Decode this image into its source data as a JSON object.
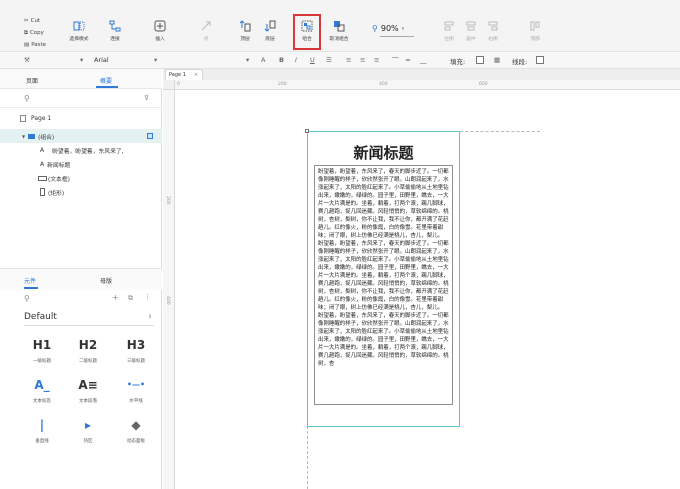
{
  "toolbar": {
    "clipboard": {
      "cut": "Cut",
      "copy": "Copy",
      "paste": "Paste"
    },
    "buttons": {
      "select_mode": "选择模式",
      "connect": "连接",
      "insert": "插入",
      "point": "点",
      "top_layer": "顶层",
      "bottom_layer": "底层",
      "group": "组合",
      "ungroup": "取消组合",
      "align_left": "左侧",
      "align_center": "居中",
      "align_right": "右侧",
      "top": "顶部"
    },
    "zoom": "90%"
  },
  "format_bar": {
    "font": "Arial",
    "fill_label": "填充:",
    "line_label": "线段:"
  },
  "left_panel": {
    "tabs": {
      "pages": "页面",
      "outline": "概要"
    },
    "page_name": "Page 1",
    "outline": [
      {
        "label": "(组合)",
        "type": "group"
      },
      {
        "label": "盼望着，盼望着，东风来了,",
        "type": "text"
      },
      {
        "label": "新闻标题",
        "type": "text"
      },
      {
        "label": "(文本框)",
        "type": "textbox"
      },
      {
        "label": "(矩形)",
        "type": "rect"
      }
    ],
    "lib_tabs": {
      "widgets": "元件",
      "masters": "母版"
    },
    "library": "Default",
    "widgets": [
      {
        "glyph": "H1",
        "label": "一级标题"
      },
      {
        "glyph": "H2",
        "label": "二级标题"
      },
      {
        "glyph": "H3",
        "label": "三级标题"
      },
      {
        "glyph": "A_",
        "label": "文本标签"
      },
      {
        "glyph": "A≡",
        "label": "文本段落"
      },
      {
        "glyph": "•—•",
        "label": "水平线"
      },
      {
        "glyph": "|",
        "label": "垂直线"
      },
      {
        "glyph": "▸",
        "label": "热区"
      },
      {
        "glyph": "◆",
        "label": "动态面板"
      }
    ]
  },
  "canvas": {
    "tab_label": "Page 1",
    "ruler_h": [
      "0",
      "200",
      "400",
      "600"
    ],
    "ruler_v": [
      "200",
      "400"
    ],
    "news_title": "新闻标题",
    "body_text": "盼望着，盼望着，东风来了，春天的脚步近了。一切都像刚睡醒的样子，欣欣然张开了眼。山朗润起来了，水涨起来了，太阳的脸红起来了。小草偷偷地从土地里钻出来，嫩嫩的，绿绿的。园子里，田野里，瞧去，一大片一大片满是的。坐着，躺着，打两个滚，踢几脚球，赛几趟跑，捉几回迷藏。风轻悄悄的，草软绵绵的。桃树，杏树，梨树，你不让我，我不让你，都开满了花赶趟儿。红的像火，粉的像霞，白的像雪。花里带着甜味；闭了眼，树上仿佛已经满是桃儿，杏儿，梨儿。    盼望着，盼望着，东风来了，春天的脚步近了。一切都像刚睡醒的样子，欣欣然张开了眼。山朗润起来了，水涨起来了，太阳的脸红起来了。小草偷偷地从土地里钻出来，嫩嫩的，绿绿的。园子里，田野里，瞧去，一大片一大片满是的。坐着，躺着，打两个滚，踢几脚球，赛几趟跑，捉几回迷藏。风轻悄悄的，草软绵绵的。桃树，杏树，梨树，你不让我，我不让你，都开满了花赶趟儿。红的像火，粉的像霞，白的像雪。花里带着甜味；闭了眼，树上仿佛已经满是桃儿，杏儿，梨儿。    盼望着，盼望着，东风来了，春天的脚步近了。一切都像刚睡醒的样子，欣欣然张开了眼。山朗润起来了，水涨起来了，太阳的脸红起来了。小草偷偷地从土地里钻出来，嫩嫩的，绿绿的。园子里，田野里，瞧去，一大片一大片满是的。坐着，躺着，打两个滚，踢几脚球，赛几趟跑，捉几回迷藏。风轻悄悄的，草软绵绵的。桃树，杏"
  },
  "colors": {
    "accent": "#2f79d8",
    "selection": "#5cc6c8",
    "highlight": "#d9373d"
  }
}
